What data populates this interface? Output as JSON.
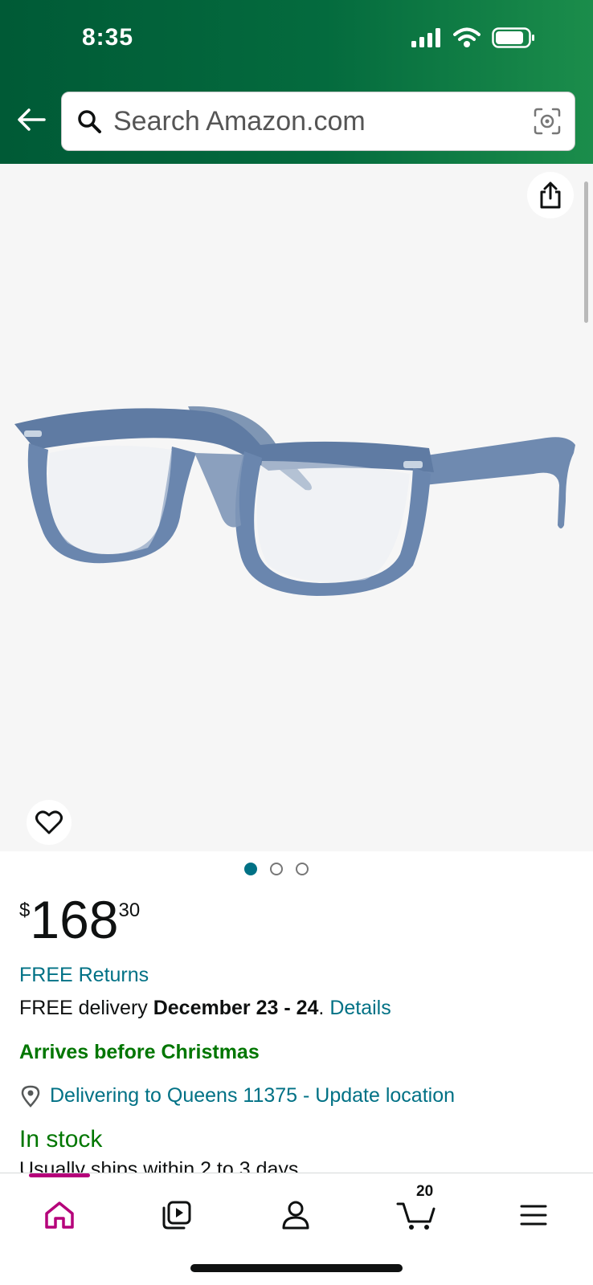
{
  "status_bar": {
    "time": "8:35"
  },
  "search": {
    "placeholder": "Search Amazon.com"
  },
  "gallery": {
    "page_count": 3,
    "active_index": 0
  },
  "product": {
    "price_symbol": "$",
    "price_whole": "168",
    "price_fraction": "30",
    "free_returns": "FREE Returns",
    "delivery_prefix": "FREE delivery ",
    "delivery_dates": "December 23 - 24",
    "delivery_period": ".",
    "delivery_details": "Details",
    "arrives": "Arrives before Christmas",
    "location": "Delivering to Queens 11375 - Update location",
    "stock": "In stock",
    "ships": "Usually ships within 2 to 3 days."
  },
  "bottom_nav": {
    "items": [
      "home",
      "video",
      "account",
      "cart",
      "menu"
    ],
    "cart_count": "20",
    "active": "home"
  },
  "colors": {
    "header_start": "#005a36",
    "header_end": "#1b8d4b",
    "link": "#007185",
    "success": "#007600",
    "active_nav": "#b5007a"
  }
}
